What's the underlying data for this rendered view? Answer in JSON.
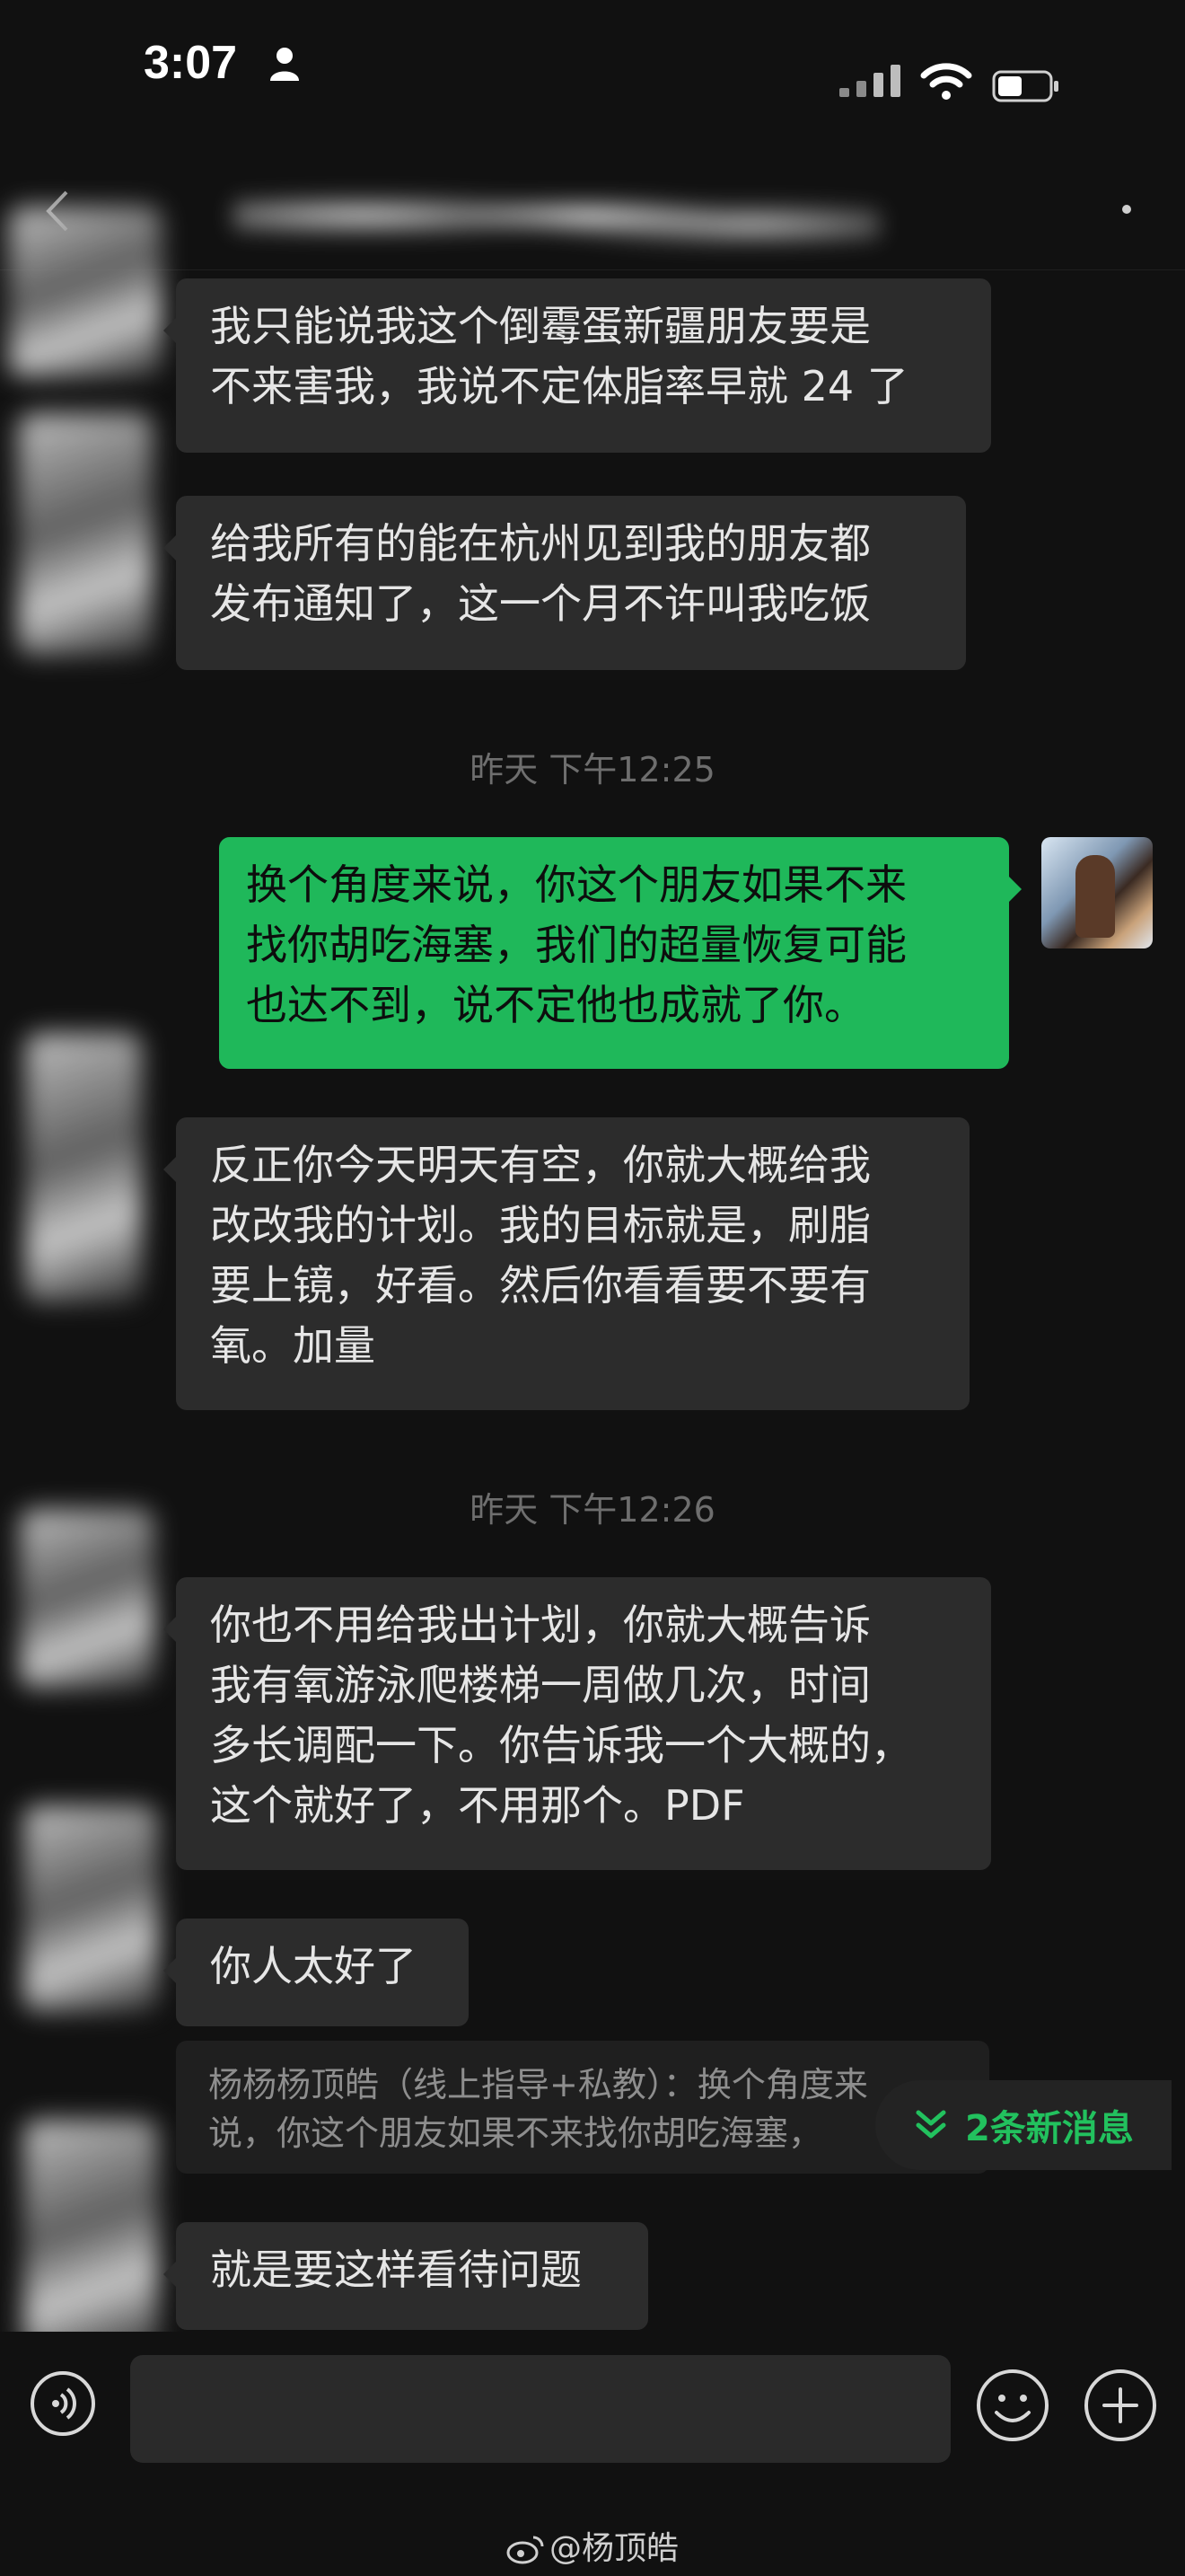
{
  "status_bar": {
    "time": "3:07"
  },
  "messages": [
    {
      "lines": [
        "我只能说我这个倒霉蛋新疆朋友要是",
        "不来害我，我说不定体脂率早就 24 了"
      ]
    },
    {
      "lines": [
        "给我所有的能在杭州见到我的朋友都",
        "发布通知了，这一个月不许叫我吃饭"
      ]
    },
    {
      "lines": [
        "换个角度来说，你这个朋友如果不来",
        "找你胡吃海塞，我们的超量恢复可能",
        "也达不到，说不定他也成就了你。"
      ]
    },
    {
      "lines": [
        "反正你今天明天有空，你就大概给我",
        "改改我的计划。我的目标就是，刷脂",
        "要上镜，好看。然后你看看要不要有",
        "氧。加量"
      ]
    },
    {
      "lines": [
        "你也不用给我出计划，你就大概告诉",
        "我有氧游泳爬楼梯一周做几次，时间",
        "多长调配一下。你告诉我一个大概的，",
        "这个就好了，不用那个。PDF"
      ]
    },
    {
      "lines": [
        "你人太好了"
      ]
    },
    {
      "lines": [
        "就是要这样看待问题"
      ]
    }
  ],
  "timestamps": [
    "昨天 下午12:25",
    "昨天 下午12:26"
  ],
  "quote": {
    "lines": [
      "杨杨杨顶皓（线上指导+私教）：换个角度来",
      "说，你这个朋友如果不来找你胡吃海塞，"
    ]
  },
  "new_messages_pill": "2条新消息",
  "watermark": "@杨顶皓",
  "colors": {
    "background": "#111111",
    "incoming_bubble": "#2c2c2c",
    "outgoing_bubble": "#1fb85a",
    "accent": "#22c15e"
  },
  "icons": [
    "person-icon",
    "signal-icon",
    "wifi-icon",
    "battery-icon",
    "back-icon",
    "voice-icon",
    "emoji-icon",
    "plus-icon",
    "chevrons-down-icon",
    "weibo-icon"
  ]
}
